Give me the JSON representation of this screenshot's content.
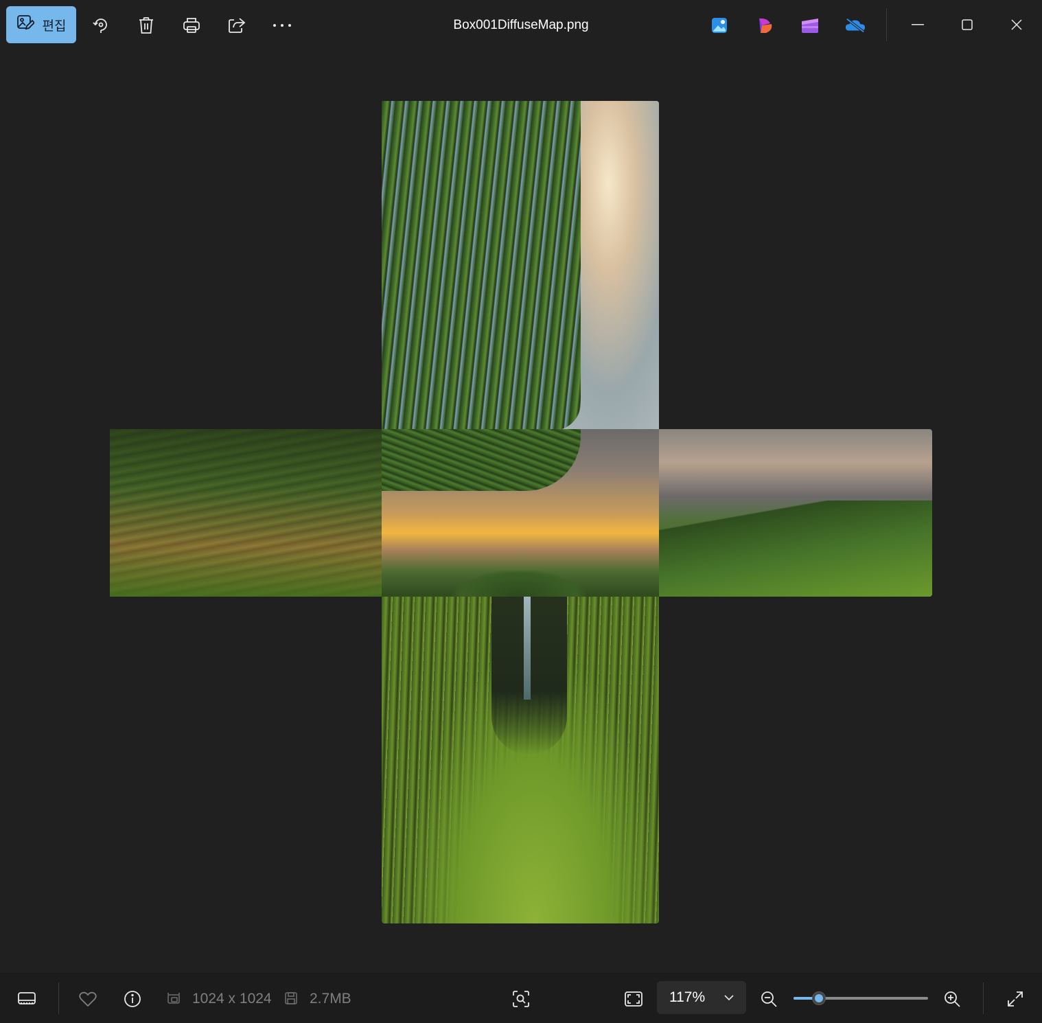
{
  "titlebar": {
    "edit_label": "편집",
    "file_name": "Box001DiffuseMap.png",
    "left_buttons": [
      "edit-button",
      "rotate-button",
      "delete-button",
      "print-button",
      "share-button",
      "more-button"
    ],
    "app_icons": [
      "photos-editor-icon",
      "clipchamp-icon",
      "movie-maker-icon",
      "onedrive-icon"
    ],
    "window_buttons": [
      "minimize-button",
      "maximize-button",
      "close-button"
    ]
  },
  "image": {
    "description_layout": "cross",
    "colors": {
      "accent": "#77b8ec",
      "background": "#202020"
    }
  },
  "statusbar": {
    "dimensions": "1024 x 1024",
    "file_size": "2.7MB",
    "zoom": "117%",
    "zoom_level": 0.19
  }
}
